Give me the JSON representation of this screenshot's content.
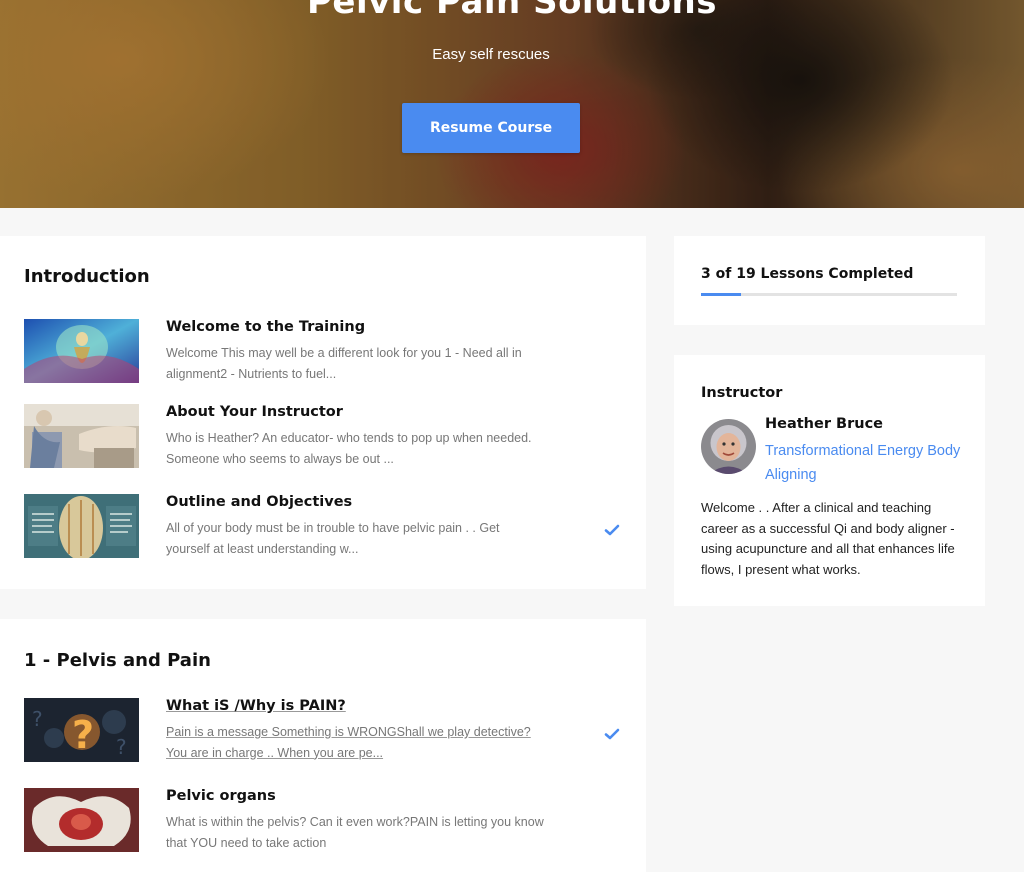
{
  "hero": {
    "title": "Pelvic Pain Solutions",
    "subtitle": "Easy self rescues",
    "resume_label": "Resume Course"
  },
  "sections": [
    {
      "title": "Introduction",
      "lessons": [
        {
          "title": "Welcome to the Training",
          "description": "Welcome  This may well be a different look for you 1 - Need all in alignment2 - Nutrients to fuel...",
          "completed": false
        },
        {
          "title": "About Your Instructor",
          "description": "Who is Heather? An educator- who tends to pop up when needed. Someone who seems to always be out ...",
          "completed": false
        },
        {
          "title": "Outline and Objectives",
          "description": "All of your body must be in trouble to have pelvic pain . . Get yourself at least understanding w...",
          "completed": true
        }
      ]
    },
    {
      "title": "1 - Pelvis and Pain",
      "lessons": [
        {
          "title": "What iS /Why is PAIN?",
          "description": "Pain is a message Something is WRONGShall we play detective?You are in charge ..  When you are pe...",
          "completed": true
        },
        {
          "title": "Pelvic organs",
          "description": "What is within the pelvis? Can it even work?PAIN is letting you know that YOU need to take action",
          "completed": false
        }
      ]
    }
  ],
  "progress": {
    "label": "3 of 19 Lessons Completed",
    "completed": 3,
    "total": 19
  },
  "instructor": {
    "heading": "Instructor",
    "name": "Heather Bruce",
    "title": "Transformational Energy Body Aligning",
    "bio": "Welcome . . After a clinical and teaching career as a successful Qi and body aligner - using acupuncture and all that enhances life flows, I present what works."
  },
  "colors": {
    "accent": "#4a8bf0",
    "page_bg": "#f7f7f7",
    "card_bg": "#ffffff"
  },
  "icons": {
    "completed": "checkmark-icon"
  }
}
